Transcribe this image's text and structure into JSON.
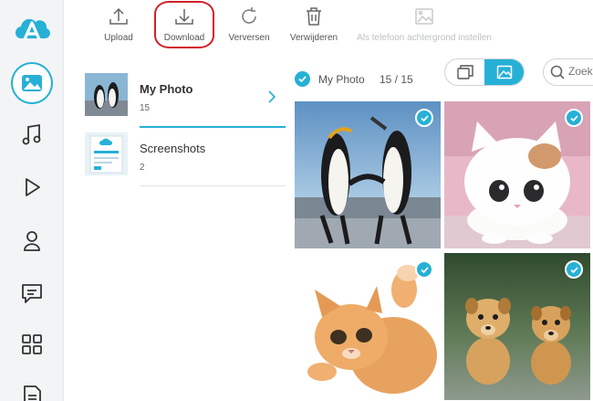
{
  "toolbar": {
    "upload": "Upload",
    "download": "Download",
    "refresh": "Verversen",
    "delete": "Verwijderen",
    "set_wallpaper": "Als telefoon achtergrond instellen"
  },
  "nav": {
    "items": [
      "photos-icon",
      "music-icon",
      "video-icon",
      "contacts-icon",
      "messages-icon",
      "apps-icon",
      "files-icon"
    ]
  },
  "albums": [
    {
      "name": "My Photo",
      "count": "15"
    },
    {
      "name": "Screenshots",
      "count": "2"
    }
  ],
  "photo_header": {
    "album": "My Photo",
    "selection": "15 / 15",
    "search_placeholder": "Zoek"
  },
  "colors": {
    "accent": "#27b0d6",
    "highlight_ring": "#d0202a"
  }
}
